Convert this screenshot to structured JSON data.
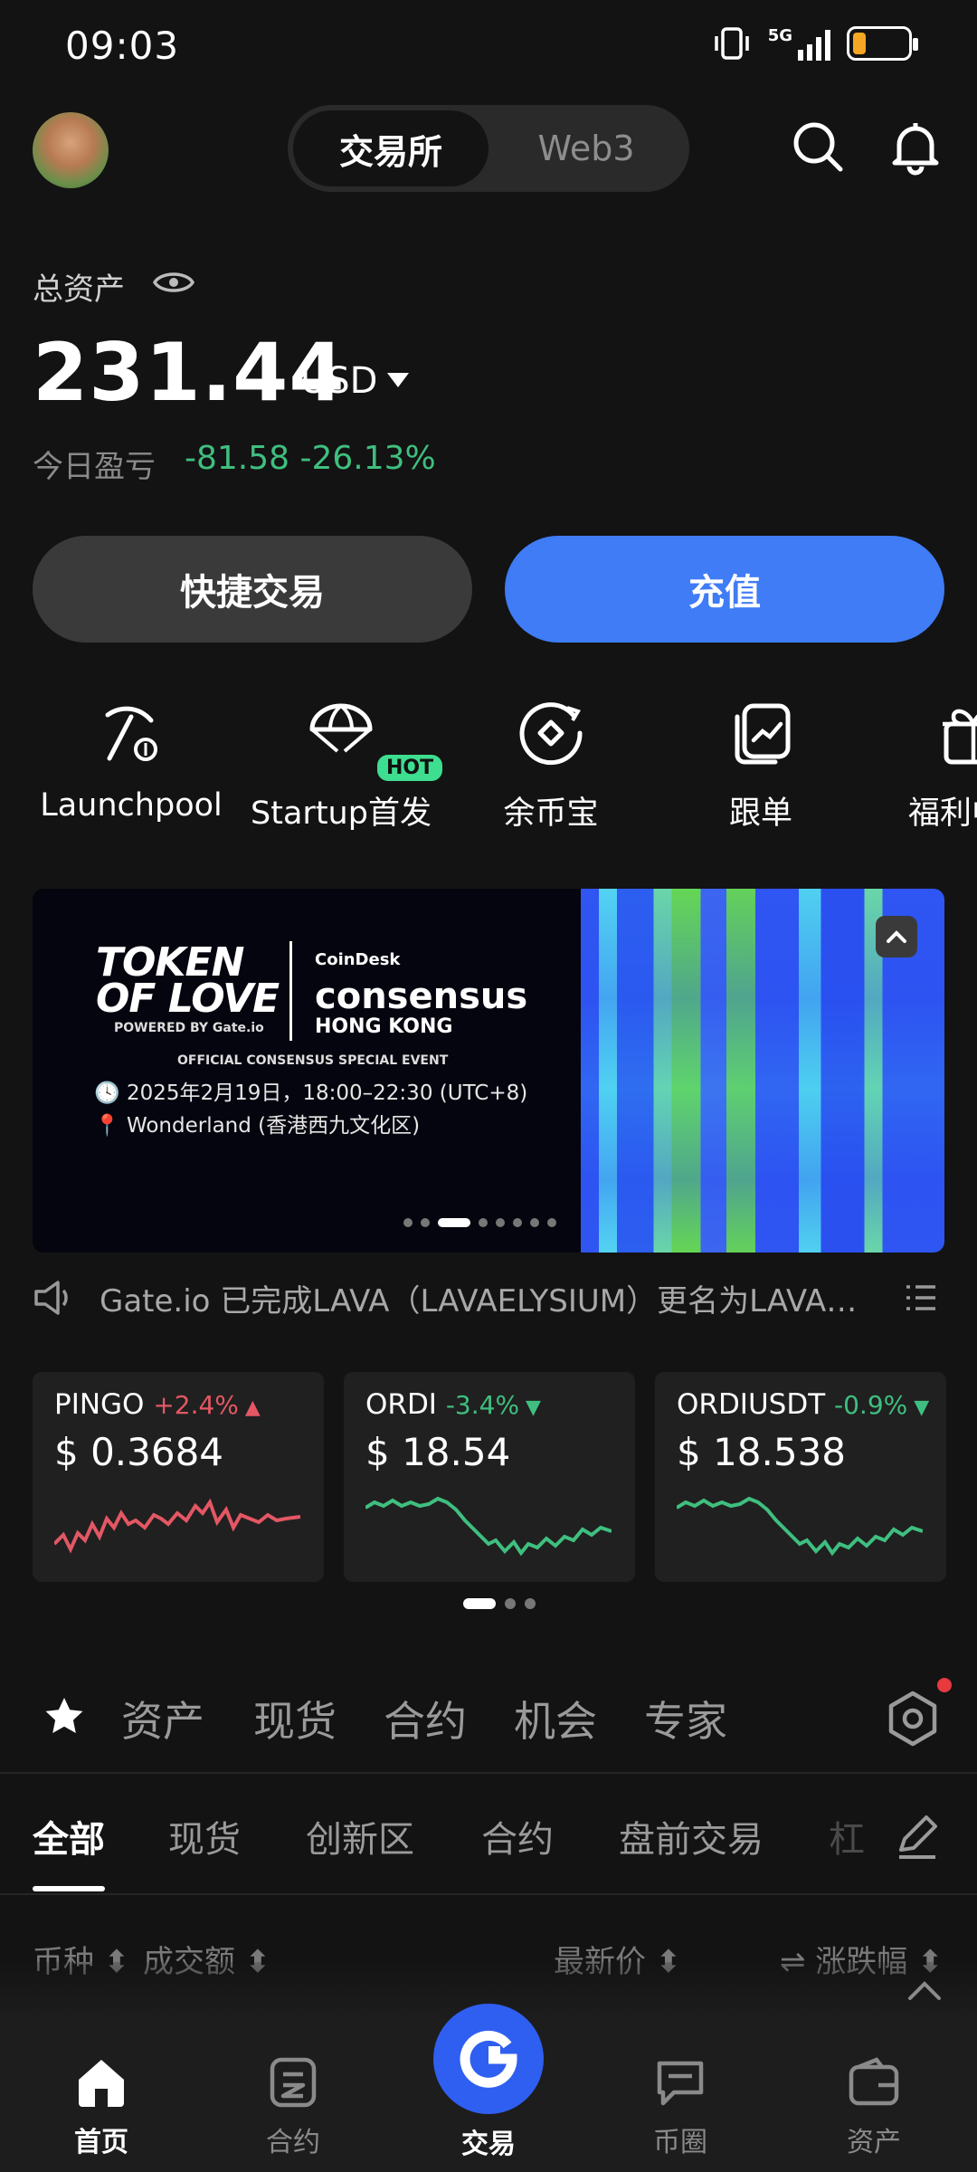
{
  "status_bar": {
    "time": "09:03",
    "network": "5G"
  },
  "header": {
    "segment": [
      "交易所",
      "Web3"
    ],
    "active_segment": "交易所"
  },
  "assets": {
    "label": "总资产",
    "value": "231.44",
    "unit": "USD",
    "pnl_label": "今日盈亏",
    "pnl_value": "-81.58 -26.13%"
  },
  "actions": {
    "quick_trade": "快捷交易",
    "deposit": "充值"
  },
  "shortcuts": [
    {
      "label": "Launchpool",
      "icon": "pickaxe-icon"
    },
    {
      "label": "Startup首发",
      "icon": "parachute-icon",
      "badge": "HOT"
    },
    {
      "label": "余币宝",
      "icon": "coin-vault-icon"
    },
    {
      "label": "跟单",
      "icon": "copy-trade-icon"
    },
    {
      "label": "福利中",
      "icon": "gift-icon"
    }
  ],
  "banner": {
    "title_line1": "TOKEN",
    "title_line2": "OF LOVE",
    "powered": "POWERED BY Gate.io",
    "coindesk": "CoinDesk",
    "consensus": "consensus",
    "hong_kong": "HONG KONG",
    "official": "OFFICIAL CONSENSUS SPECIAL EVENT",
    "date": "2025年2月19日，18:00–22:30 (UTC+8)",
    "location": "Wonderland (香港西九文化区)",
    "dot_count": 8,
    "active_dot": 2
  },
  "announcement": "Gate.io 已完成LAVA（LAVAELYSIUM）更名为LAVA…",
  "tickers": [
    {
      "symbol": "PINGO",
      "change": "+2.4%",
      "direction": "up",
      "price": "$ 0.3684",
      "color": "#e45764"
    },
    {
      "symbol": "ORDI",
      "change": "-3.4%",
      "direction": "down",
      "price": "$ 18.54",
      "color": "#3fbf7f"
    },
    {
      "symbol": "ORDIUSDT",
      "change": "-0.9%",
      "direction": "down",
      "price": "$ 18.538",
      "color": "#3fbf7f"
    }
  ],
  "category_tabs": [
    "资产",
    "现货",
    "合约",
    "机会",
    "专家"
  ],
  "sub_tabs": [
    "全部",
    "现货",
    "创新区",
    "合约",
    "盘前交易",
    "杠"
  ],
  "active_sub_tab": "全部",
  "columns": {
    "coin": "币种",
    "volume": "成交额",
    "price": "最新价",
    "change": "涨跌幅"
  },
  "bottom_nav": [
    {
      "label": "首页",
      "icon": "home-icon",
      "active": true
    },
    {
      "label": "合约",
      "icon": "contract-icon",
      "active": false
    },
    {
      "label": "交易",
      "icon": "trade-logo-icon",
      "active": false
    },
    {
      "label": "币圈",
      "icon": "chat-icon",
      "active": false
    },
    {
      "label": "资产",
      "icon": "wallet-icon",
      "active": false
    }
  ],
  "colors": {
    "accent": "#3f7cf5",
    "up": "#e45764",
    "down": "#3fbf7f",
    "background": "#131313"
  }
}
